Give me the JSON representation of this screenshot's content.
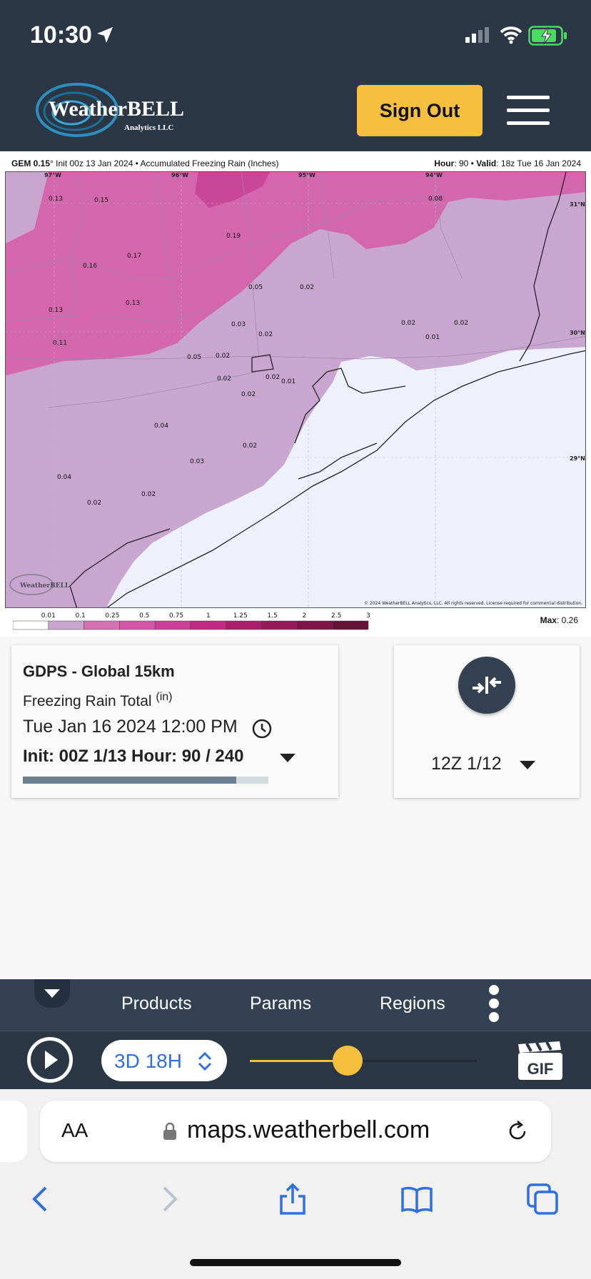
{
  "status": {
    "time": "10:30"
  },
  "header": {
    "logo_text": "WeatherBELL",
    "logo_subtext": "Analytics LLC",
    "signout_label": "Sign Out"
  },
  "map": {
    "title_model": "GEM 0.15",
    "title_rest": "° Init 00z 13 Jan 2024 • Accumulated Freezing Rain (Inches)",
    "hour_label": "Hour",
    "hour_value": "90",
    "valid_label": "Valid",
    "valid_value": "18z Tue 16 Jan 2024",
    "lon_labels": [
      "97°W",
      "96°W",
      "95°W",
      "94°W"
    ],
    "lat_labels": [
      "31°N",
      "30°N",
      "29°N"
    ],
    "values": [
      "0.13",
      "0.15",
      "0.19",
      "0.08",
      "0.17",
      "0.16",
      "0.05",
      "0.02",
      "0.13",
      "0.13",
      "0.03",
      "0.02",
      "0.02",
      "0.02",
      "0.01",
      "0.11",
      "0.05",
      "0.02",
      "0.02",
      "0.02",
      "0.01",
      "0.02",
      "0.04",
      "0.02",
      "0.03",
      "0.04",
      "0.02",
      "0.02"
    ],
    "copyright": "© 2024 WeatherBELL Analytics, LLC. All rights reserved. License required for commercial distribution.",
    "watermark": "WeatherBELL",
    "legend_ticks": [
      "0.01",
      "0.1",
      "0.25",
      "0.5",
      "0.75",
      "1",
      "1.25",
      "1.5",
      "2",
      "2.5",
      "3"
    ],
    "legend_colors": [
      "#ffffff",
      "#c9a6cf",
      "#d372b4",
      "#d357a6",
      "#cc3f96",
      "#c02a82",
      "#ab1e6c",
      "#951a5c",
      "#7d1549",
      "#651237"
    ],
    "max_label": "Max",
    "max_value": "0.26"
  },
  "card": {
    "model": "GDPS - Global 15km",
    "param": "Freezing Rain Total",
    "param_unit": "(in)",
    "valid": "Tue Jan 16 2024 12:00 PM",
    "init_hour": "Init: 00Z 1/13  Hour: 90 / 240",
    "progress": 0.87
  },
  "compare": {
    "run": "12Z 1/12"
  },
  "toolbar": {
    "products": "Products",
    "params": "Params",
    "regions": "Regions",
    "speed": "3D 18H",
    "gif": "GIF",
    "slider_fraction": 0.43
  },
  "safari": {
    "aa": "AA",
    "url": "maps.weatherbell.com"
  },
  "colors": {
    "header": "#2c3746",
    "toolbar": "#344152",
    "accent": "#f6c03e",
    "safari_blue": "#2f6fe0"
  }
}
